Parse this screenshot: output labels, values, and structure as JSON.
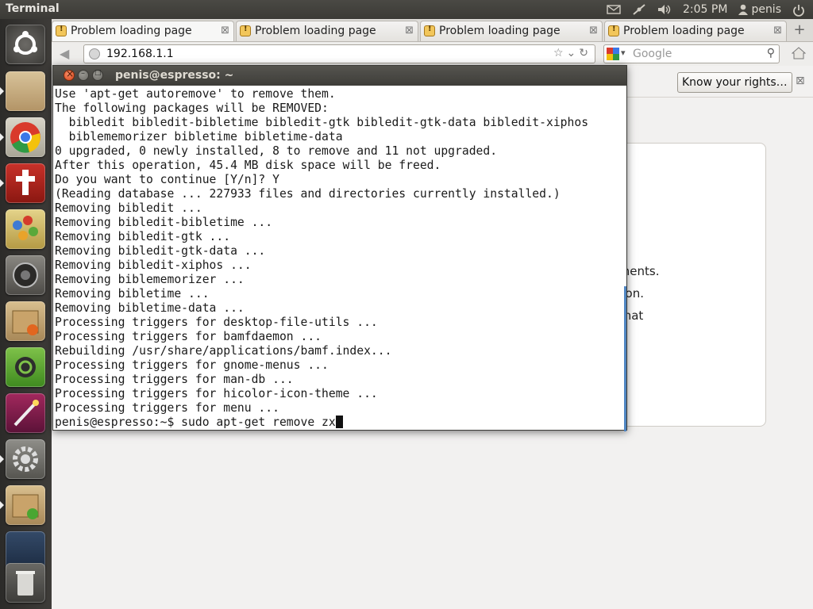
{
  "top_panel": {
    "app_title": "Terminal",
    "clock": "2:05 PM",
    "user": "penis"
  },
  "launcher": {
    "items": [
      {
        "name": "dash-home-icon"
      },
      {
        "name": "files-folder-icon"
      },
      {
        "name": "chrome-browser-icon"
      },
      {
        "name": "bible-app-icon"
      },
      {
        "name": "paint-app-icon"
      },
      {
        "name": "speaker-app-icon"
      },
      {
        "name": "package-installer-icon"
      },
      {
        "name": "ubuntu-software-icon"
      },
      {
        "name": "magic-wand-icon"
      },
      {
        "name": "system-settings-icon"
      },
      {
        "name": "package-download-icon"
      },
      {
        "name": "workspace-switcher-icon"
      },
      {
        "name": "trash-icon"
      }
    ]
  },
  "browser": {
    "tabs": [
      {
        "label": "Problem loading page"
      },
      {
        "label": "Problem loading page"
      },
      {
        "label": "Problem loading page"
      },
      {
        "label": "Problem loading page"
      }
    ],
    "new_tab": "+",
    "url": "192.168.1.1",
    "search_placeholder": "Google",
    "rights_button": "Know your rights…",
    "content_lines": [
      "noments.",
      "ection.",
      "re that"
    ]
  },
  "terminal": {
    "title": "penis@espresso: ~",
    "lines": [
      "Use 'apt-get autoremove' to remove them.",
      "The following packages will be REMOVED:",
      "  bibledit bibledit-bibletime bibledit-gtk bibledit-gtk-data bibledit-xiphos",
      "  biblememorizer bibletime bibletime-data",
      "0 upgraded, 0 newly installed, 8 to remove and 11 not upgraded.",
      "After this operation, 45.4 MB disk space will be freed.",
      "Do you want to continue [Y/n]? Y",
      "(Reading database ... 227933 files and directories currently installed.)",
      "Removing bibledit ...",
      "Removing bibledit-bibletime ...",
      "Removing bibledit-gtk ...",
      "Removing bibledit-gtk-data ...",
      "Removing bibledit-xiphos ...",
      "Removing biblememorizer ...",
      "Removing bibletime ...",
      "Removing bibletime-data ...",
      "Processing triggers for desktop-file-utils ...",
      "Processing triggers for bamfdaemon ...",
      "Rebuilding /usr/share/applications/bamf.index...",
      "Processing triggers for gnome-menus ...",
      "Processing triggers for man-db ...",
      "Processing triggers for hicolor-icon-theme ...",
      "Processing triggers for menu ..."
    ],
    "prompt": "penis@espresso:~$ sudo apt-get remove zx"
  }
}
